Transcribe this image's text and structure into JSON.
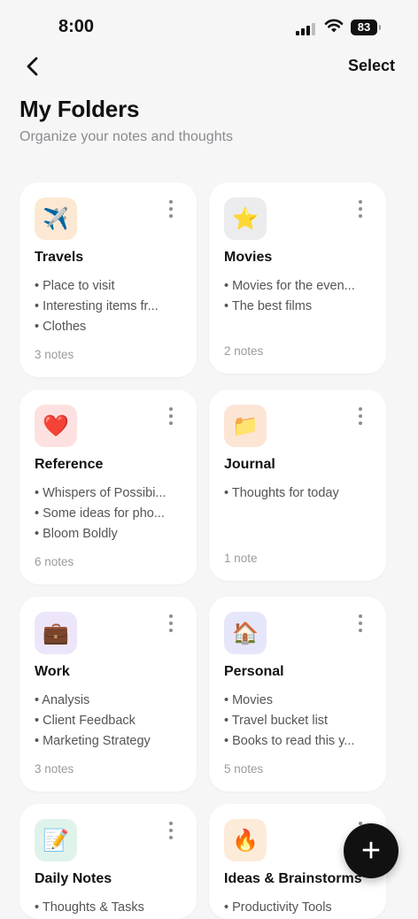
{
  "status": {
    "time": "8:00",
    "battery": "83"
  },
  "nav": {
    "select_label": "Select"
  },
  "header": {
    "title": "My Folders",
    "subtitle": "Organize your notes and thoughts"
  },
  "colors": {
    "fab": "#111111",
    "background": "#f6f6f7"
  },
  "folders": [
    {
      "name": "Travels",
      "icon": "airplane-icon",
      "glyph": "✈️",
      "tint": "#fde9d3",
      "items": [
        "• Place to visit",
        "• Interesting items fr...",
        "• Clothes"
      ],
      "count": "3 notes"
    },
    {
      "name": "Movies",
      "icon": "star-icon",
      "glyph": "⭐",
      "tint": "#ececee",
      "items": [
        "• Movies for the even...",
        "• The best films"
      ],
      "count": "2 notes"
    },
    {
      "name": "Reference",
      "icon": "heart-icon",
      "glyph": "❤️",
      "tint": "#fde1e1",
      "items": [
        "• Whispers of Possibi...",
        "• Some ideas for pho...",
        "• Bloom Boldly"
      ],
      "count": "6 notes"
    },
    {
      "name": "Journal",
      "icon": "folder-icon",
      "glyph": "📁",
      "tint": "#fde5d5",
      "items": [
        "• Thoughts for today"
      ],
      "count": "1 note"
    },
    {
      "name": "Work",
      "icon": "briefcase-icon",
      "glyph": "💼",
      "tint": "#ede6fb",
      "items": [
        "• Analysis",
        "• Client Feedback",
        "• Marketing Strategy"
      ],
      "count": "3 notes"
    },
    {
      "name": "Personal",
      "icon": "house-icon",
      "glyph": "🏠",
      "tint": "#e6e6fb",
      "items": [
        "• Movies",
        "• Travel bucket list",
        "• Books to read this y..."
      ],
      "count": "5 notes"
    },
    {
      "name": "Daily Notes",
      "icon": "memo-icon",
      "glyph": "📝",
      "tint": "#dff3ea",
      "items": [
        "• Thoughts & Tasks"
      ],
      "count": ""
    },
    {
      "name": "Ideas & Brainstorms",
      "icon": "fire-icon",
      "glyph": "🔥",
      "tint": "#fdebd9",
      "items": [
        "• Productivity Tools"
      ],
      "count": ""
    }
  ],
  "fab": {
    "label": "+"
  }
}
